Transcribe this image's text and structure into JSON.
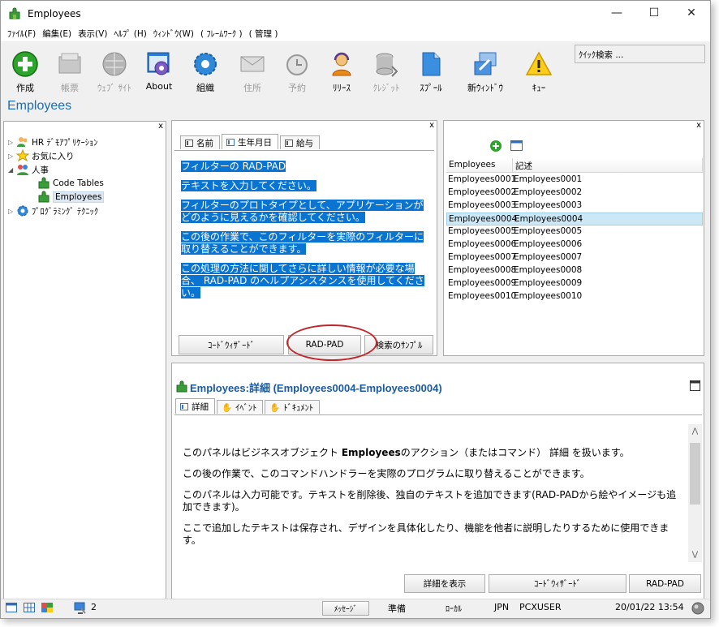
{
  "window": {
    "title": "Employees",
    "minimize": "—",
    "maximize": "☐",
    "close": "✕"
  },
  "menu": [
    "ﾌｧｲﾙ(F)",
    "編集(E)",
    "表示(V)",
    "ﾍﾙﾌﾟ (H)",
    "ｳｨﾝﾄﾞｳ(W)",
    "( ﾌﾚｰﾑﾜｰｸ )",
    "( 管理 )"
  ],
  "toolbar": {
    "create": "作成",
    "ledger": "帳票",
    "website": "ｳｪﾌﾞ ｻｲﾄ",
    "about": "About",
    "org": "組織",
    "address": "住所",
    "reserve": "予約",
    "release": "ﾘﾘｰｽ",
    "credit": "ｸﾚｼﾞｯﾄ",
    "spool": "ｽﾌﾟｰﾙ",
    "newwindow": "新ｳｨﾝﾄﾞｳ",
    "queue": "ｷｭｰ"
  },
  "quicksearch": "ｸｲｯｸ検索 ...",
  "page_title": "Employees",
  "tree": {
    "hr": "HR ﾃﾞﾓｱﾌﾟﾘｹｰｼｮﾝ",
    "favorites": "お気に入り",
    "personnel": "人事",
    "code_tables": "Code Tables",
    "employees": "Employees",
    "programming": "ﾌﾟﾛｸﾞﾗﾐﾝｸﾞ ﾃｸﾆｯｸ"
  },
  "filter": {
    "tabs": [
      "名前",
      "生年月日",
      "給与"
    ],
    "lines": [
      "フィルターの RAD-PAD",
      "テキストを入力してください。",
      "フィルターのプロトタイプとして、アプリケーションがどのように見えるかを確認してください。",
      "この後の作業で、このフィルターを実際のフィルターに取り替えることができます。",
      "この処理の方法に関してさらに詳しい情報が必要な場合、 RAD-PAD のヘルプアシスタンスを使用してください。"
    ],
    "btn_code": "ｺｰﾄﾞｳｨｻﾞｰﾄﾞ",
    "btn_radpad": "RAD-PAD",
    "btn_sample": "検索のｻﾝﾌﾟﾙ"
  },
  "list": {
    "columns": [
      "Employees",
      "記述"
    ],
    "rows": [
      [
        "Employees0001",
        "Employees0001"
      ],
      [
        "Employees0002",
        "Employees0002"
      ],
      [
        "Employees0003",
        "Employees0003"
      ],
      [
        "Employees0004",
        "Employees0004"
      ],
      [
        "Employees0005",
        "Employees0005"
      ],
      [
        "Employees0006",
        "Employees0006"
      ],
      [
        "Employees0007",
        "Employees0007"
      ],
      [
        "Employees0008",
        "Employees0008"
      ],
      [
        "Employees0009",
        "Employees0009"
      ],
      [
        "Employees0010",
        "Employees0010"
      ]
    ],
    "selected_index": 3
  },
  "detail": {
    "title": "Employees:詳細 (Employees0004-Employees0004)",
    "tabs": [
      "詳細",
      "ｲﾍﾞﾝﾄ",
      "ﾄﾞｷｭﾒﾝﾄ"
    ],
    "p1_pre": "このパネルはビジネスオブジェクト ",
    "p1_bold": "Employees",
    "p1_mid": "のアクション（またはコマンド） ",
    "p1_bold2": "詳細",
    "p1_post": " を扱います。",
    "p2": "この後の作業で、このコマンドハンドラーを実際のプログラムに取り替えることができます。",
    "p3": "このパネルは入力可能です。テキストを削除後、独自のテキストを追加できます(RAD-PADから絵やイメージも追加できます)。",
    "p4": "ここで追加したテキストは保存され、デザインを具体化したり、機能を他者に説明したりするために使用できます。",
    "btn_show": "詳細を表示",
    "btn_code": "ｺｰﾄﾞｳｨｻﾞｰﾄﾞ",
    "btn_radpad": "RAD-PAD"
  },
  "status": {
    "count": "2",
    "messages": "ﾒｯｾｰｼﾞ",
    "ready": "準備",
    "local": "ﾛｰｶﾙ",
    "lang": "JPN",
    "user": "PCXUSER",
    "datetime": "20/01/22 13:54"
  },
  "colors": {
    "accent": "#1e6fb0",
    "selection": "#0a74d2",
    "highlight_ring": "#c0272d"
  }
}
